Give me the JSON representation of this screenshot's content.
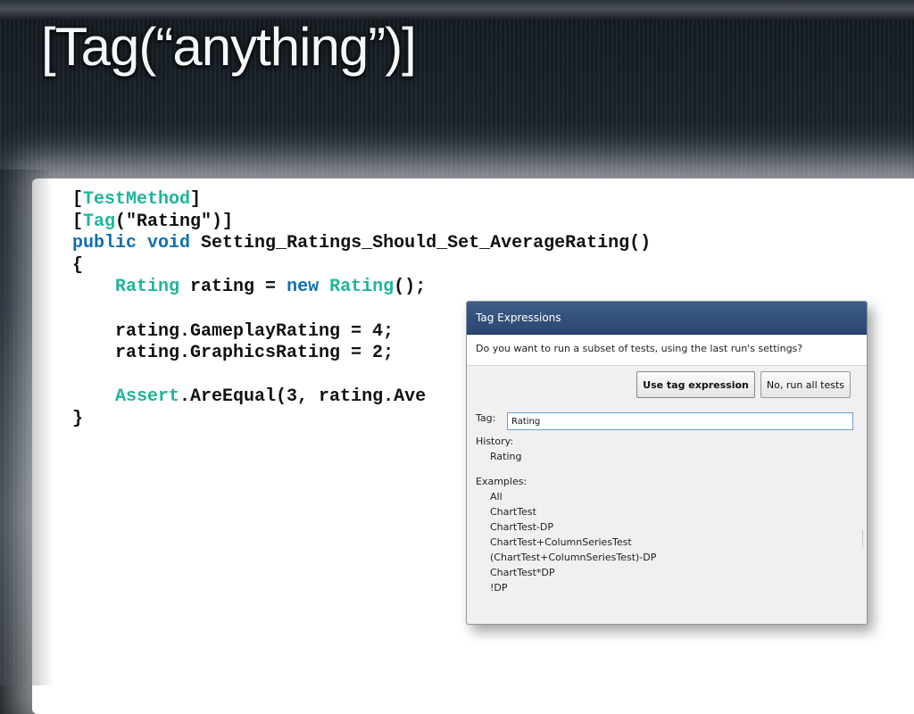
{
  "slide": {
    "title": "[Tag(“anything”)]"
  },
  "code_lines": [
    [
      {
        "t": "[",
        "c": ""
      },
      {
        "t": "TestMethod",
        "c": "ty"
      },
      {
        "t": "]",
        "c": ""
      }
    ],
    [
      {
        "t": "[",
        "c": ""
      },
      {
        "t": "Tag",
        "c": "ty"
      },
      {
        "t": "(\"Rating\")]",
        "c": ""
      }
    ],
    [
      {
        "t": "public",
        "c": "kw"
      },
      {
        "t": " ",
        "c": ""
      },
      {
        "t": "void",
        "c": "kw"
      },
      {
        "t": " Setting_Ratings_Should_Set_AverageRating()",
        "c": ""
      }
    ],
    [
      {
        "t": "{",
        "c": ""
      }
    ],
    [
      {
        "t": "    ",
        "c": ""
      },
      {
        "t": "Rating",
        "c": "ty"
      },
      {
        "t": " rating = ",
        "c": ""
      },
      {
        "t": "new",
        "c": "kw"
      },
      {
        "t": " ",
        "c": ""
      },
      {
        "t": "Rating",
        "c": "ty"
      },
      {
        "t": "();",
        "c": ""
      }
    ],
    [],
    [
      {
        "t": "    rating.GameplayRating = 4;",
        "c": ""
      }
    ],
    [
      {
        "t": "    rating.GraphicsRating = 2;",
        "c": ""
      }
    ],
    [],
    [
      {
        "t": "    ",
        "c": ""
      },
      {
        "t": "Assert",
        "c": "ty"
      },
      {
        "t": ".AreEqual(3, rating.Ave",
        "c": ""
      }
    ],
    [
      {
        "t": "}",
        "c": ""
      }
    ]
  ],
  "dialog": {
    "title": "Tag Expressions",
    "question": "Do you want to run a subset of tests, using the last run's settings?",
    "use_button": "Use tag expression",
    "no_button": "No, run all tests",
    "tag_label": "Tag:",
    "tag_value": "Rating",
    "history_label": "History:",
    "history": [
      "Rating"
    ],
    "examples_label": "Examples:",
    "examples": [
      "All",
      "ChartTest",
      "ChartTest-DP",
      "ChartTest+ColumnSeriesTest",
      "(ChartTest+ColumnSeriesTest)-DP",
      "ChartTest*DP",
      "!DP"
    ]
  },
  "colors": {
    "keyword": "#0f6fb4",
    "type": "#1fb59a",
    "dialog_titlebar": "#2a4670"
  }
}
